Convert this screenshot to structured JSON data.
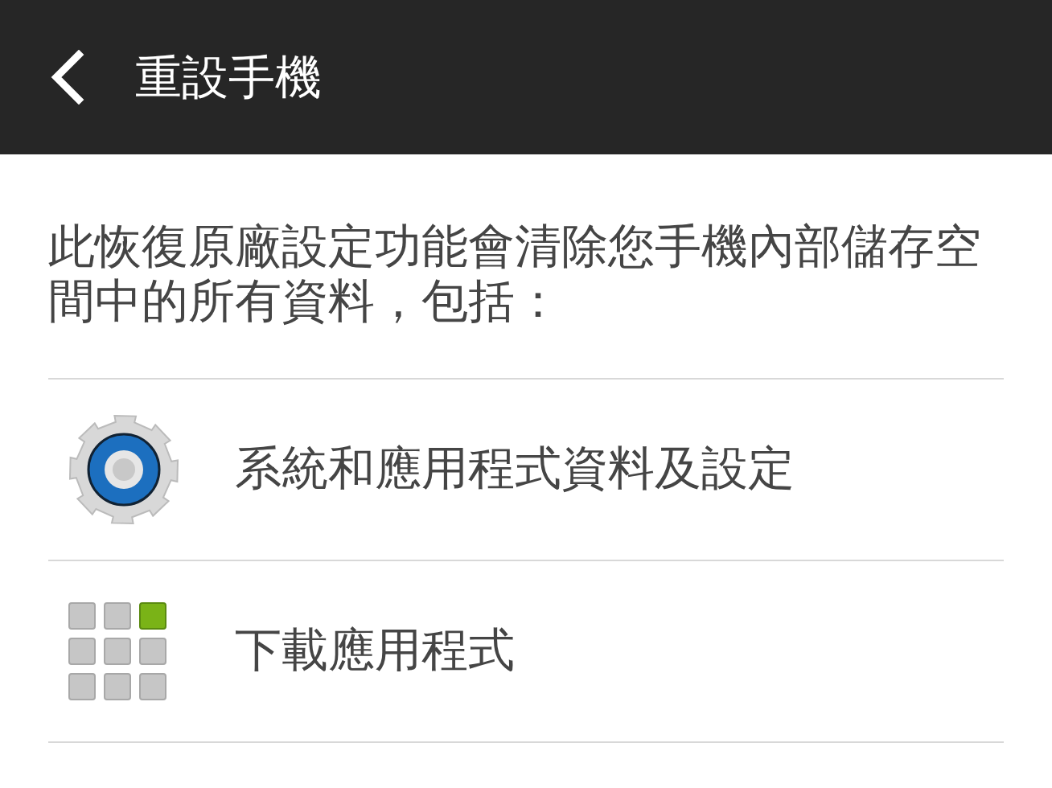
{
  "app_bar": {
    "title": "重設手機"
  },
  "description": "此恢復原廠設定功能會清除您手機內部儲存空間中的所有資料，包括：",
  "items": [
    {
      "kind": "gear",
      "label": "系統和應用程式資料及設定"
    },
    {
      "kind": "grid",
      "label": "下載應用程式"
    }
  ]
}
